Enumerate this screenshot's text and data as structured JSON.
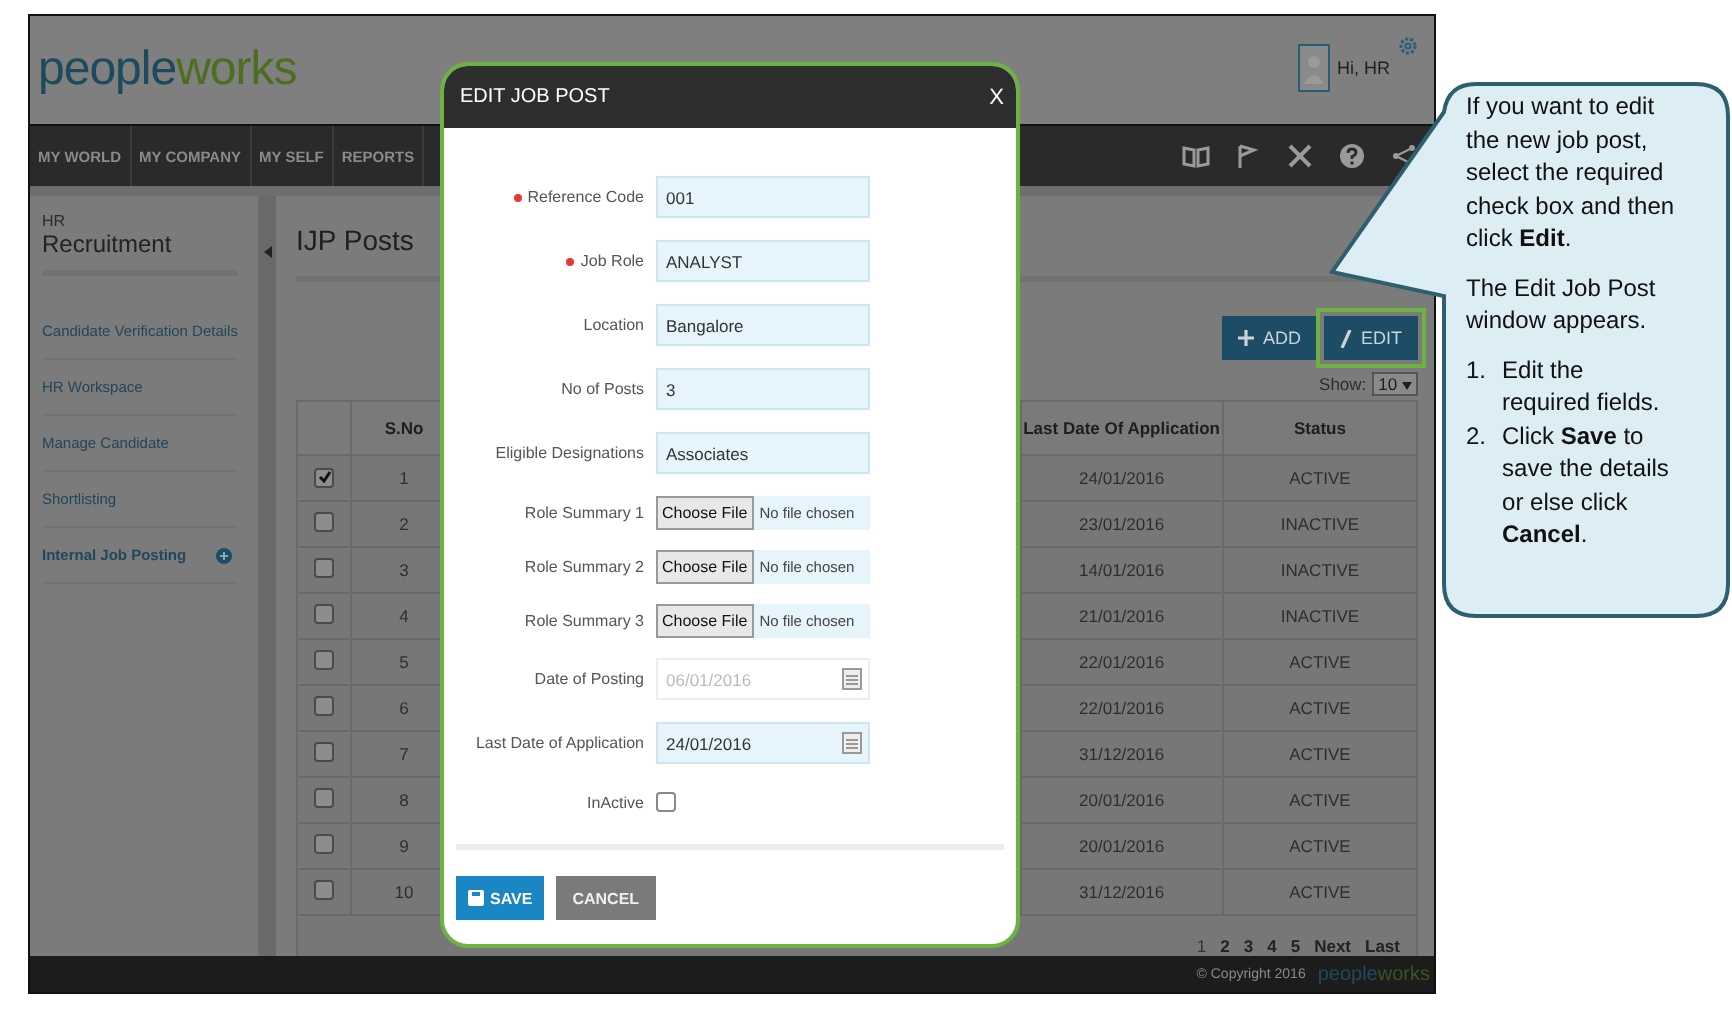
{
  "header": {
    "logo": [
      "people",
      "works"
    ],
    "greeting": "Hi, HR"
  },
  "nav": {
    "items": [
      "MY WORLD",
      "MY COMPANY",
      "MY SELF",
      "REPORTS"
    ]
  },
  "sidebar": {
    "section": "HR",
    "title": "Recruitment",
    "items": [
      {
        "label": "Candidate Verification Details",
        "selected": false
      },
      {
        "label": "HR Workspace",
        "selected": false
      },
      {
        "label": "Manage Candidate",
        "selected": false
      },
      {
        "label": "Shortlisting",
        "selected": false
      },
      {
        "label": "Internal Job Posting",
        "selected": true
      }
    ]
  },
  "main": {
    "title": "IJP Posts",
    "add_button": "ADD",
    "edit_button": "EDIT",
    "show_label": "Show:",
    "show_value": "10"
  },
  "table": {
    "columns": [
      "S.No",
      "Last Date Of Application",
      "Status"
    ],
    "rows": [
      {
        "checked": true,
        "sno": "1",
        "last_date": "24/01/2016",
        "status": "ACTIVE"
      },
      {
        "checked": false,
        "sno": "2",
        "last_date": "23/01/2016",
        "status": "INACTIVE"
      },
      {
        "checked": false,
        "sno": "3",
        "last_date": "14/01/2016",
        "status": "INACTIVE"
      },
      {
        "checked": false,
        "sno": "4",
        "last_date": "21/01/2016",
        "status": "INACTIVE"
      },
      {
        "checked": false,
        "sno": "5",
        "last_date": "22/01/2016",
        "status": "ACTIVE"
      },
      {
        "checked": false,
        "sno": "6",
        "last_date": "22/01/2016",
        "status": "ACTIVE"
      },
      {
        "checked": false,
        "sno": "7",
        "last_date": "31/12/2016",
        "status": "ACTIVE"
      },
      {
        "checked": false,
        "sno": "8",
        "last_date": "20/01/2016",
        "status": "ACTIVE"
      },
      {
        "checked": false,
        "sno": "9",
        "last_date": "20/01/2016",
        "status": "ACTIVE"
      },
      {
        "checked": false,
        "sno": "10",
        "last_date": "31/12/2016",
        "status": "ACTIVE"
      }
    ]
  },
  "pagination": [
    {
      "label": "1",
      "selected": true
    },
    {
      "label": "2",
      "selected": false
    },
    {
      "label": "3",
      "selected": false
    },
    {
      "label": "4",
      "selected": false
    },
    {
      "label": "5",
      "selected": false
    },
    {
      "label": "Next",
      "selected": false
    },
    {
      "label": "Last",
      "selected": false
    }
  ],
  "footer": {
    "copyright": "© Copyright 2016",
    "logo": [
      "people",
      "works"
    ]
  },
  "modal": {
    "title": "EDIT JOB POST",
    "close": "X",
    "fields": [
      {
        "kind": "text",
        "label": "Reference Code",
        "required": true,
        "value": "001"
      },
      {
        "kind": "text",
        "label": "Job Role",
        "required": true,
        "value": "ANALYST"
      },
      {
        "kind": "text",
        "label": "Location",
        "required": false,
        "value": "Bangalore"
      },
      {
        "kind": "text",
        "label": "No of Posts",
        "required": false,
        "value": "3"
      },
      {
        "kind": "text",
        "label": "Eligible Designations",
        "required": false,
        "value": "Associates"
      },
      {
        "kind": "file",
        "label": "Role Summary 1",
        "button": "Choose File",
        "status": "No file chosen"
      },
      {
        "kind": "file",
        "label": "Role Summary 2",
        "button": "Choose File",
        "status": "No file chosen"
      },
      {
        "kind": "file",
        "label": "Role Summary 3",
        "button": "Choose File",
        "status": "No file chosen"
      },
      {
        "kind": "date",
        "label": "Date of Posting",
        "disabled": true,
        "value": "06/01/2016"
      },
      {
        "kind": "date",
        "label": "Last Date of Application",
        "disabled": false,
        "value": "24/01/2016"
      },
      {
        "kind": "checkbox",
        "label": "InActive",
        "checked": false
      }
    ],
    "save_button": "SAVE",
    "cancel_button": "CANCEL"
  },
  "callout": {
    "paragraphs": [
      "If you want to edit the new job post, select the required check box and then click **Edit**.",
      "The Edit Job Post window appears."
    ],
    "steps": [
      {
        "number": "1.",
        "text": "Edit the required fields."
      },
      {
        "number": "2.",
        "text": "Click **Save** to save the details or else click **Cancel**."
      }
    ]
  }
}
